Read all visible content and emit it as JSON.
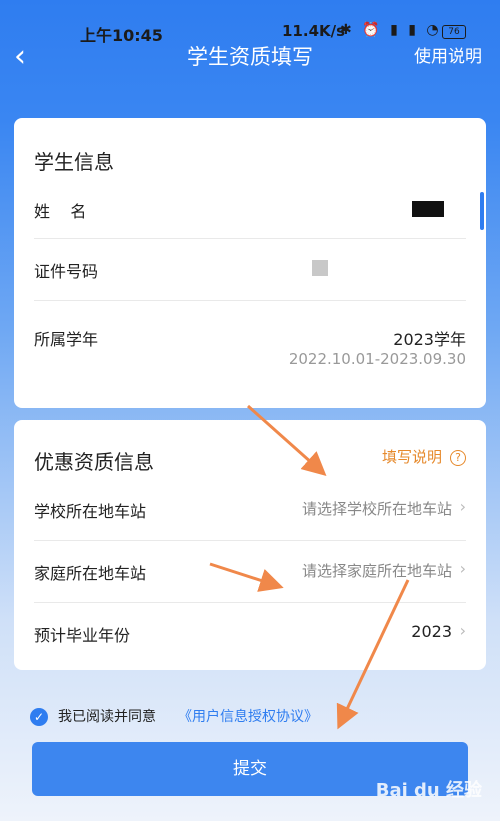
{
  "status_bar": {
    "time": "上午10:45",
    "net_speed": "11.4K/s",
    "icons": "✱ ⏰ ▮ ▮ ◔",
    "battery": "76"
  },
  "nav": {
    "back_icon": "‹",
    "title": "学生资质填写",
    "help": "使用说明"
  },
  "student_info": {
    "title": "学生信息",
    "name_label": "姓    名",
    "id_label": "证件号码",
    "year_label": "所属学年",
    "year_value": "2023学年",
    "year_period": "2022.10.01-2023.09.30"
  },
  "discount_info": {
    "title": "优惠资质信息",
    "help_link": "填写说明",
    "help_icon": "?",
    "school_label": "学校所在地车站",
    "school_placeholder": "请选择学校所在地车站",
    "home_label": "家庭所在地车站",
    "home_placeholder": "请选择家庭所在地车站",
    "grad_label": "预计毕业年份",
    "grad_value": "2023",
    "chevron": "›"
  },
  "agreement": {
    "check": "✓",
    "text": "我已阅读并同意",
    "link": "《用户信息授权协议》"
  },
  "submit": {
    "label": "提交"
  },
  "watermark": "Bai du 经验",
  "colors": {
    "primary": "#2f7df0",
    "accent_orange": "#e6892b",
    "arrow": "#f0884a"
  }
}
